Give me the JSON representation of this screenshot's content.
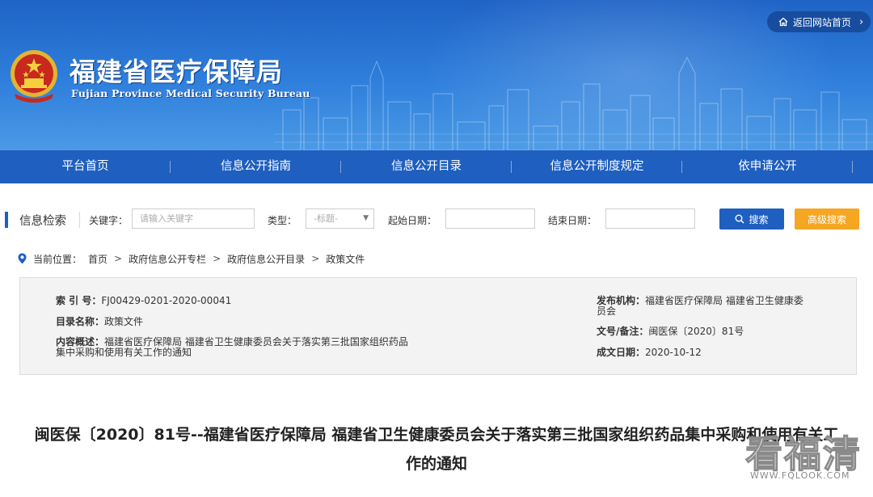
{
  "header": {
    "title_cn": "福建省医疗保障局",
    "title_en": "Fujian Province Medical Security Bureau",
    "home_button": "返回网站首页"
  },
  "nav": {
    "items": [
      {
        "label": "平台首页"
      },
      {
        "label": "信息公开指南"
      },
      {
        "label": "信息公开目录"
      },
      {
        "label": "信息公开制度规定"
      },
      {
        "label": "依申请公开"
      }
    ]
  },
  "search": {
    "title": "信息检索",
    "keyword_label": "关键字：",
    "keyword_placeholder": "请输入关键字",
    "type_label": "类型：",
    "type_value": "-标题-",
    "start_label": "起始日期：",
    "end_label": "结束日期：",
    "search_button": "搜索",
    "advanced_button": "高级搜索"
  },
  "breadcrumb": {
    "prefix": "当前位置：",
    "items": [
      "首页",
      "政府信息公开专栏",
      "政府信息公开目录",
      "政策文件"
    ],
    "separator": ">"
  },
  "info": {
    "index_label": "索 引 号：",
    "index_value": "FJ00429-0201-2020-00041",
    "catalog_label": "目录名称：",
    "catalog_value": "政策文件",
    "summary_label": "内容概述：",
    "summary_line1": "福建省医疗保障局 福建省卫生健康委员会关于落实第三批国家组织药品",
    "summary_line2": "集中采购和使用有关工作的通知",
    "publisher_label": "发布机构：",
    "publisher_line1": "福建省医疗保障局 福建省卫生健康委",
    "publisher_line2": "员会",
    "docno_label": "文号/备注：",
    "docno_value": "闽医保〔2020〕81号",
    "date_label": "成文日期：",
    "date_value": "2020-10-12"
  },
  "article": {
    "title_line1": "闽医保〔2020〕81号--福建省医疗保障局 福建省卫生健康委员会关于落实第三批国家组织药品集中采购和使用有关工",
    "title_line2": "作的通知"
  },
  "watermark": {
    "text": "看福清",
    "url": "WWW.FQLOOK.COM"
  },
  "colors": {
    "banner": "#2f7fdc",
    "nav": "#1f5fbf",
    "search_button": "#1f5fbf",
    "advanced_button": "#f5a623",
    "info_bg": "#f3f3f3"
  }
}
